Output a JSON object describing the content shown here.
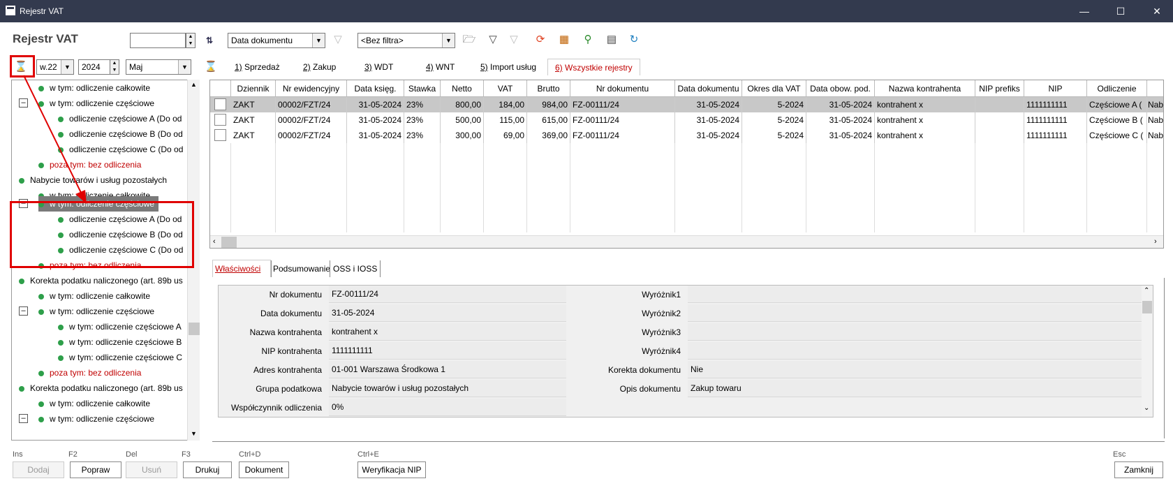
{
  "window": {
    "title": "Rejestr VAT"
  },
  "header": {
    "title": "Rejestr VAT"
  },
  "toolbar": {
    "date_field": "Data dokumentu",
    "filter": "<Bez filtra>"
  },
  "period": {
    "week": "w.22",
    "year": "2024",
    "month": "Maj"
  },
  "tabs": [
    {
      "key": "1)",
      "label": " Sprzedaż"
    },
    {
      "key": "2)",
      "label": " Zakup"
    },
    {
      "key": "3)",
      "label": " WDT"
    },
    {
      "key": "4)",
      "label": " WNT"
    },
    {
      "key": "5)",
      "label": " Import usług"
    },
    {
      "key": "6)",
      "label": " Wszystkie rejestry"
    }
  ],
  "tree": [
    "w tym: odliczenie całkowite",
    "w tym: odliczenie częściowe",
    "odliczenie częściowe A (Do od",
    "odliczenie częściowe B (Do od",
    "odliczenie częściowe C (Do od",
    "poza tym: bez odliczenia",
    "Nabycie towarów i usług pozostałych",
    "w tym: odliczenie całkowite",
    "w tym: odliczenie częściowe",
    "odliczenie częściowe A (Do od",
    "odliczenie częściowe B (Do od",
    "odliczenie częściowe C (Do od",
    "poza tym: bez odliczenia",
    "Korekta podatku naliczonego (art. 89b us",
    "w tym: odliczenie całkowite",
    "w tym: odliczenie częściowe",
    "w tym: odliczenie częściowe A",
    "w tym: odliczenie częściowe B",
    "w tym: odliczenie częściowe C",
    "poza tym: bez odliczenia",
    "Korekta podatku naliczonego (art. 89b us",
    "w tym: odliczenie całkowite",
    "w tym: odliczenie częściowe"
  ],
  "grid": {
    "columns": [
      "Dziennik",
      "Nr ewidencyjny",
      "Data księg.",
      "Stawka",
      "Netto",
      "VAT",
      "Brutto",
      "Nr dokumentu",
      "Data dokumentu",
      "Okres dla VAT",
      "Data obow. pod.",
      "Nazwa kontrahenta",
      "NIP prefiks",
      "NIP",
      "Odliczenie",
      ""
    ],
    "rows": [
      [
        "ZAKT",
        "00002/FZT/24",
        "31-05-2024",
        "23%",
        "800,00",
        "184,00",
        "984,00",
        "FZ-00111/24",
        "31-05-2024",
        "5-2024",
        "31-05-2024",
        "kontrahent x",
        "",
        "1111111111",
        "Częściowe A (",
        "Nab"
      ],
      [
        "ZAKT",
        "00002/FZT/24",
        "31-05-2024",
        "23%",
        "500,00",
        "115,00",
        "615,00",
        "FZ-00111/24",
        "31-05-2024",
        "5-2024",
        "31-05-2024",
        "kontrahent x",
        "",
        "1111111111",
        "Częściowe B (",
        "Nab"
      ],
      [
        "ZAKT",
        "00002/FZT/24",
        "31-05-2024",
        "23%",
        "300,00",
        "69,00",
        "369,00",
        "FZ-00111/24",
        "31-05-2024",
        "5-2024",
        "31-05-2024",
        "kontrahent x",
        "",
        "1111111111",
        "Częściowe C (",
        "Nab"
      ]
    ]
  },
  "panel_tabs": [
    "Właściwości",
    "Podsumowanie",
    "OSS i IOSS"
  ],
  "props_left": [
    {
      "label": "Nr dokumentu",
      "value": "FZ-00111/24"
    },
    {
      "label": "Data dokumentu",
      "value": "31-05-2024"
    },
    {
      "label": "Nazwa kontrahenta",
      "value": "kontrahent x"
    },
    {
      "label": "NIP kontrahenta",
      "value": "1111111111"
    },
    {
      "label": "Adres kontrahenta",
      "value": "01-001 Warszawa Środkowa 1"
    },
    {
      "label": "Grupa podatkowa",
      "value": "Nabycie towarów i usług pozostałych"
    },
    {
      "label": "Współczynnik odliczenia",
      "value": "0%"
    }
  ],
  "props_right": [
    {
      "label": "Wyróżnik1",
      "value": ""
    },
    {
      "label": "Wyróżnik2",
      "value": ""
    },
    {
      "label": "Wyróżnik3",
      "value": ""
    },
    {
      "label": "Wyróżnik4",
      "value": ""
    },
    {
      "label": "Korekta dokumentu",
      "value": "Nie"
    },
    {
      "label": "Opis dokumentu",
      "value": "Zakup towaru"
    }
  ],
  "footer": {
    "keys": {
      "ins": "Ins",
      "f2": "F2",
      "del": "Del",
      "f3": "F3",
      "ctrld": "Ctrl+D",
      "ctrle": "Ctrl+E",
      "esc": "Esc"
    },
    "buttons": {
      "dodaj": "Dodaj",
      "popraw": "Popraw",
      "usun": "Usuń",
      "drukuj": "Drukuj",
      "dokument": "Dokument",
      "weryfikacja": "Weryfikacja NIP",
      "zamknij": "Zamknij"
    }
  },
  "colors": {
    "titlebar": "#333a4e",
    "highlight_red": "#e00000",
    "selected_row": "#c8c8c8",
    "tree_dot": "#2e9f4a"
  }
}
